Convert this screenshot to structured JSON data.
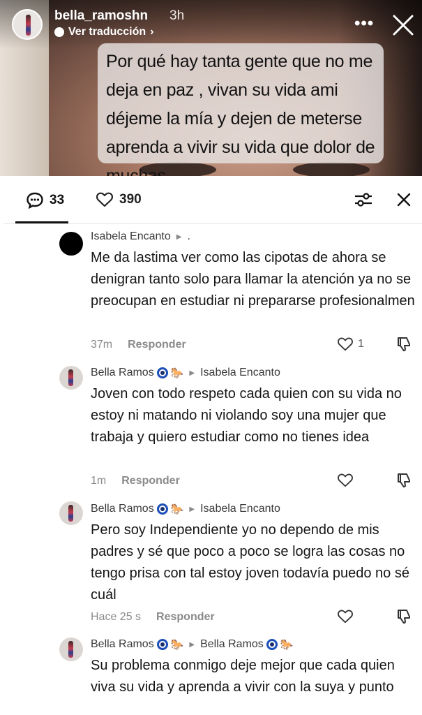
{
  "story": {
    "username": "bella_ramoshn",
    "time": "3h",
    "translate_label": "Ver traducción",
    "text": "Por qué hay tanta gente que no me deja en paz , vivan su vida ami déjeme la mía y dejen de meterse aprenda a vivir su vida que dolor de muchas"
  },
  "sheet": {
    "comments_count": "33",
    "likes_count": "390"
  },
  "comments": [
    {
      "author": "Isabela Encanto",
      "suffix": ".",
      "text": "Me da lastima ver como las cipotas de ahora se denigran tanto solo para llamar la atención ya no se preocupan en estudiar ni prepararse profesionalmen",
      "time": "37m",
      "reply_label": "Responder",
      "likes": "1"
    },
    {
      "author": "Bella Ramos",
      "reply_to": "Isabela Encanto",
      "text": "Joven con todo respeto cada quien con su vida no estoy ni matando ni violando soy una mujer que trabaja y quiero estudiar como no tienes idea",
      "time": "1m",
      "reply_label": "Responder"
    },
    {
      "author": "Bella Ramos",
      "reply_to": "Isabela Encanto",
      "text": "Pero soy Independiente yo no dependo de mis padres y sé que poco a poco se logra las cosas no tengo prisa con tal estoy joven todavía puedo no sé cuál",
      "time": "Hace 25 s",
      "reply_label": "Responder"
    },
    {
      "author": "Bella Ramos",
      "reply_to": "Bella Ramos",
      "text": "Su problema conmigo deje mejor que cada quien viva su vida y aprenda a vivir con la suya y punto"
    }
  ],
  "icons": {
    "comment": "comment-bubble-icon",
    "heart": "heart-icon",
    "filter": "filter-sliders-icon",
    "close": "close-icon",
    "dislike": "dislike-icon",
    "more": "more-icon",
    "translate": "translate-icon",
    "eye_emoji": "nazar-eye-emoji",
    "horse_emoji": "horse-emoji"
  }
}
